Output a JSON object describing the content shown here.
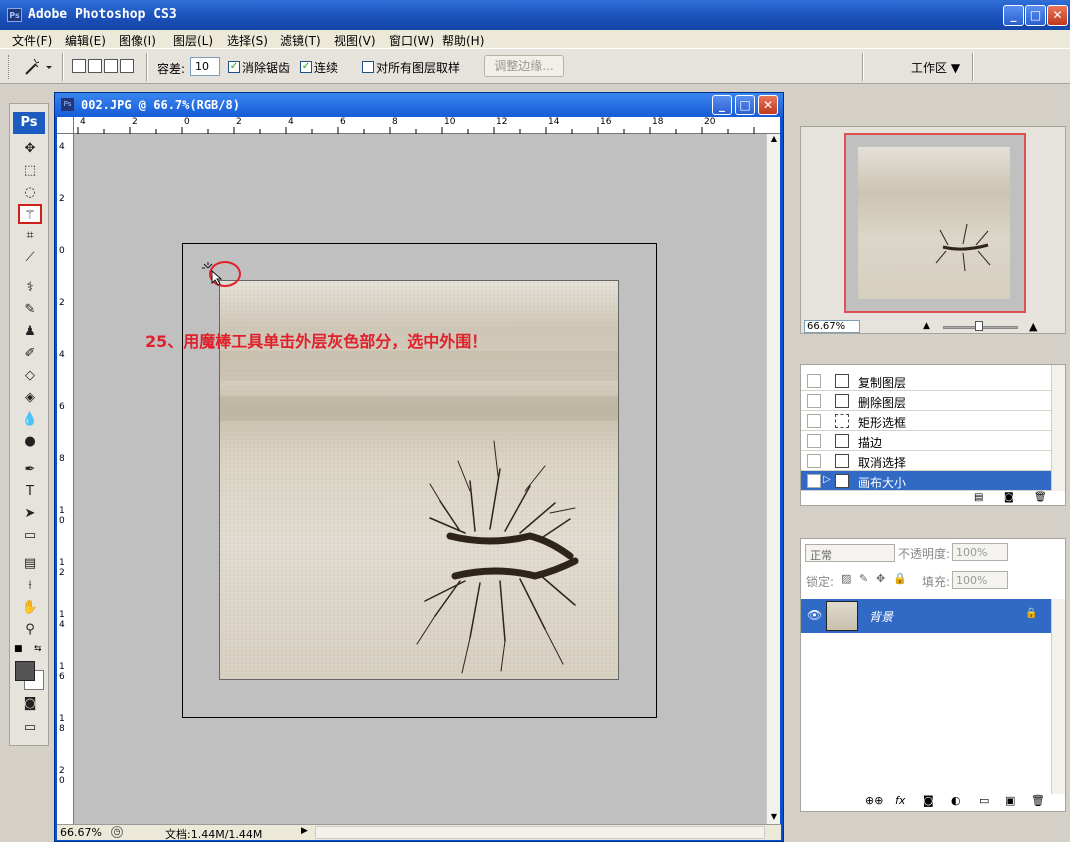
{
  "app": {
    "logo_text": "Ps",
    "title": "Adobe Photoshop CS3",
    "window_buttons": {
      "minimize": "_",
      "maximize": "□",
      "close": "✕"
    }
  },
  "menu": [
    "文件(F)",
    "编辑(E)",
    "图像(I)",
    "图层(L)",
    "选择(S)",
    "滤镜(T)",
    "视图(V)",
    "窗口(W)",
    "帮助(H)"
  ],
  "options": {
    "tolerance_label": "容差:",
    "tolerance_value": "10",
    "antialias_label": "消除锯齿",
    "antialias_checked": "✓",
    "contiguous_label": "连续",
    "contiguous_checked": "✓",
    "sample_all_label": "对所有图层取样",
    "refine_edge_label": "调整边缘...",
    "workspace_label": "工作区 ▼"
  },
  "toolbox": {
    "logo": "Ps"
  },
  "document": {
    "title": "002.JPG @ 66.7%(RGB/8)",
    "ruler_h": [
      "4",
      "2",
      "0",
      "2",
      "4",
      "6",
      "8",
      "10",
      "12",
      "14",
      "16",
      "18",
      "20"
    ],
    "ruler_v": [
      "4",
      "2",
      "0",
      "2",
      "4",
      "6",
      "8",
      "10",
      "12",
      "14",
      "16",
      "18",
      "20"
    ],
    "annotation": "25、用魔棒工具单击外层灰色部分，选中外围！",
    "status_zoom": "66.67%",
    "status_doc": "文档:1.44M/1.44M"
  },
  "navigator": {
    "zoom": "66.67%"
  },
  "history": {
    "items": [
      "复制图层",
      "删除图层",
      "矩形选框",
      "描边",
      "取消选择",
      "画布大小"
    ],
    "selected_index": 5
  },
  "layers": {
    "blend_mode": "正常",
    "opacity_label": "不透明度:",
    "opacity_value": "100%",
    "lock_label": "锁定:",
    "fill_label": "填充:",
    "fill_value": "100%",
    "layer_name": "背景",
    "bottom_icons": [
      "⊕⊕",
      "fx",
      "◙",
      "◐",
      "▭",
      "▣",
      "🗑"
    ]
  },
  "colors": {
    "accent": "#316ac5",
    "annotation_red": "#e0202a",
    "canvas_gray": "#c0c0c0"
  }
}
